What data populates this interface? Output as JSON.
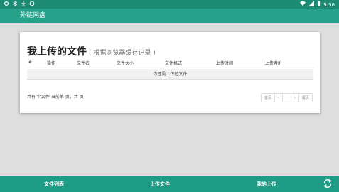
{
  "status_bar": {
    "left_icons": [
      "settings-icon",
      "bluetooth-icon",
      "download-icon",
      "circle-icon"
    ],
    "time": "9:36"
  },
  "app_bar": {
    "title": "外链网盘"
  },
  "card": {
    "title": "我上传的文件",
    "subtitle": "( 根据浏览器缓存记录 )",
    "table": {
      "columns": [
        "#",
        "操作",
        "文件名",
        "文件大小",
        "文件格式",
        "上传时间",
        "上传者IP"
      ],
      "empty_message": "你还没上传过文件"
    },
    "footer_info": "共有 个文件 当前第 页，共 页",
    "pagination": {
      "first": "首页",
      "prev": "‹",
      "current": "",
      "next": "›",
      "last": "尾页"
    }
  },
  "bottom_nav": {
    "items": [
      "文件列表",
      "上传文件",
      "我的上传"
    ]
  },
  "colors": {
    "status_bar": "#1d8a73",
    "app_bar": "#26a28b",
    "bottom_nav": "#1f9c86",
    "background": "#dedede"
  }
}
